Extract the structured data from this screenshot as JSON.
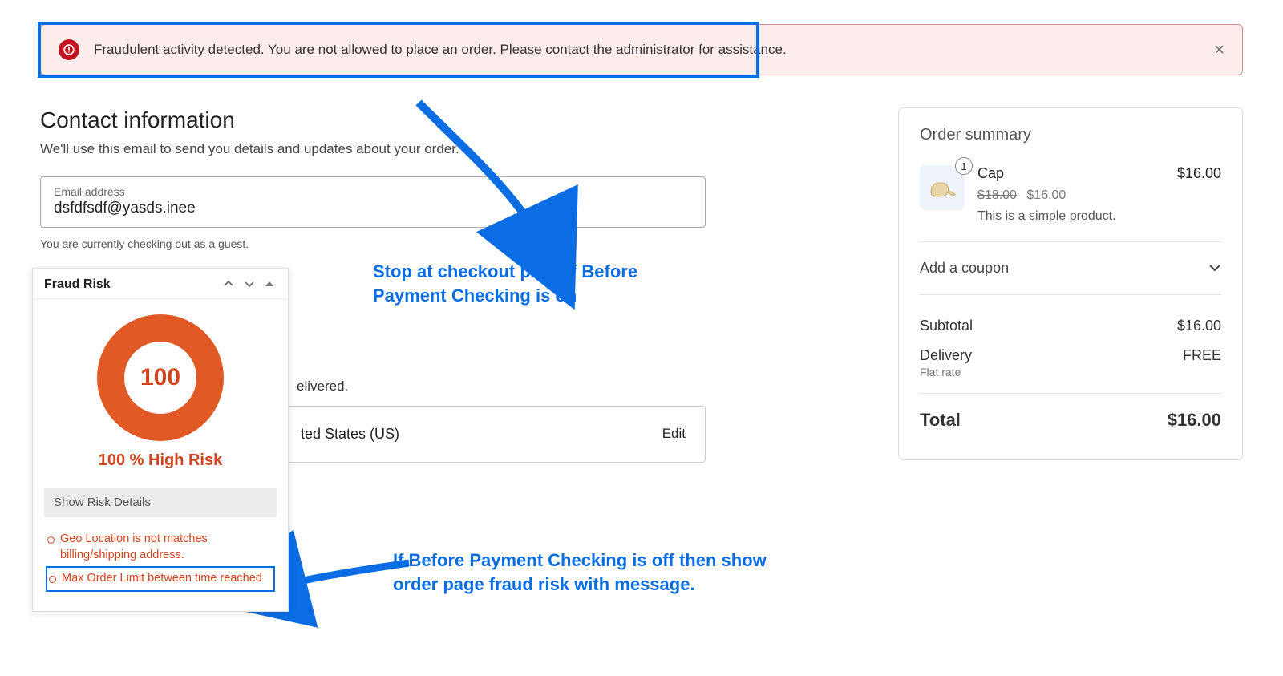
{
  "alert": {
    "message": "Fraudulent activity detected. You are not allowed to place an order. Please contact the administrator for assistance.",
    "close_label": "×"
  },
  "contact": {
    "title": "Contact information",
    "subtitle": "We'll use this email to send you details and updates about your order.",
    "email_label": "Email address",
    "email_value": "dsfdfsdf@yasds.inee",
    "guest_note": "You are currently checking out as a guest."
  },
  "callouts": {
    "one": "Stop at checkout page if Before Payment Checking is on",
    "two": "If Before Payment Checking is off then show order page fraud risk with message."
  },
  "fraud": {
    "header": "Fraud Risk",
    "score": "100",
    "risk_label": "100 % High Risk",
    "show_details": "Show Risk Details",
    "reasons": [
      "Geo Location is not matches billing/shipping address.",
      "Max Order Limit between time reached"
    ]
  },
  "shipping": {
    "hint": "elivered.",
    "address_tail": "ted States (US)",
    "edit": "Edit"
  },
  "summary": {
    "title": "Order summary",
    "item": {
      "qty": "1",
      "name": "Cap",
      "original": "$18.00",
      "price": "$16.00",
      "desc": "This is a simple product.",
      "line_total": "$16.00"
    },
    "coupon_label": "Add a coupon",
    "subtotal_label": "Subtotal",
    "subtotal_value": "$16.00",
    "delivery_label": "Delivery",
    "delivery_sub": "Flat rate",
    "delivery_value": "FREE",
    "total_label": "Total",
    "total_value": "$16.00"
  }
}
